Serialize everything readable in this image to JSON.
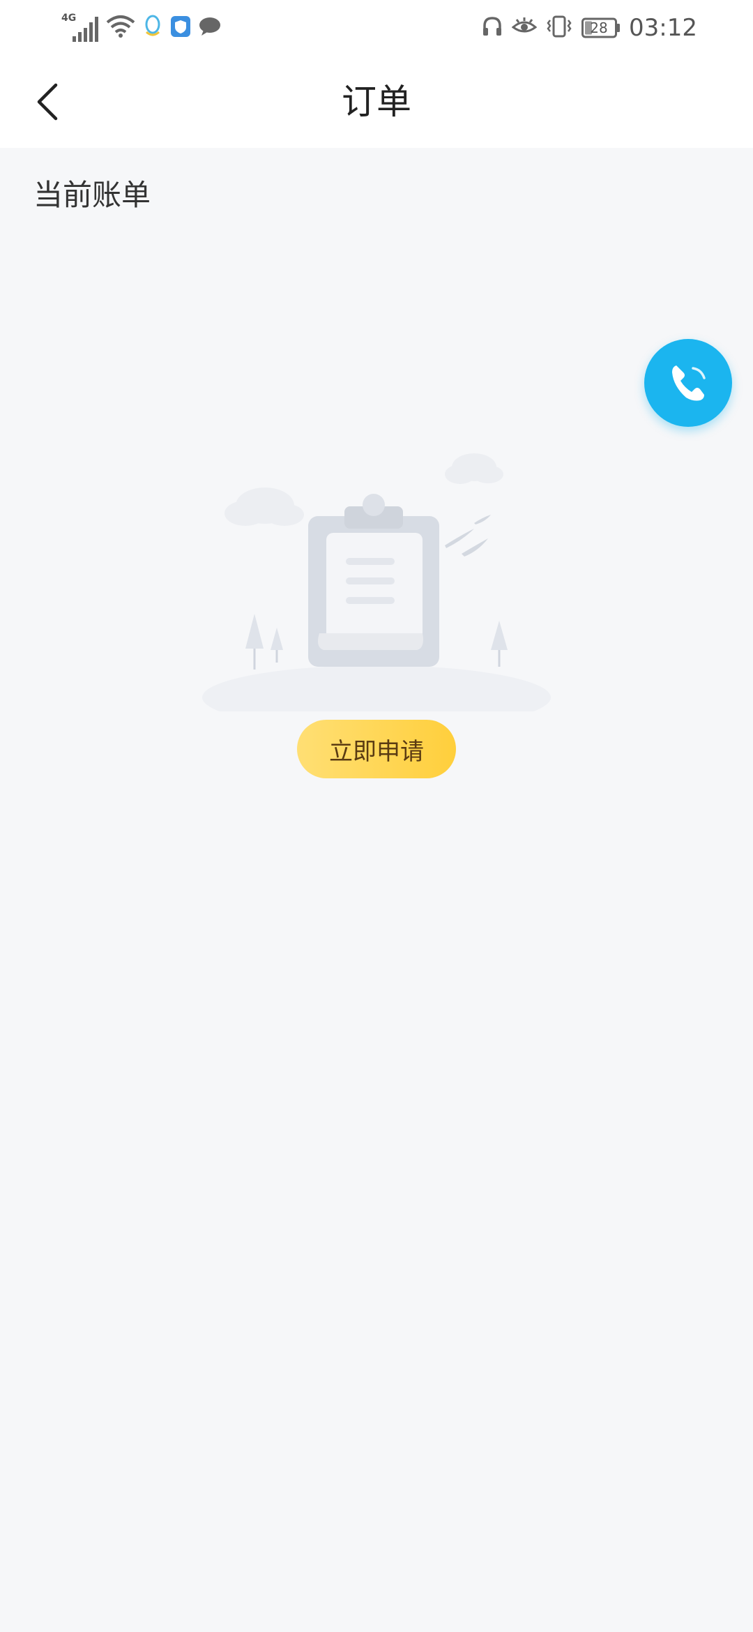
{
  "status_bar": {
    "network": "4G",
    "battery": "28",
    "time": "03:12"
  },
  "header": {
    "title": "订单"
  },
  "section": {
    "title": "当前账单"
  },
  "empty_state": {
    "button_label": "立即申请"
  },
  "colors": {
    "accent_blue": "#1bb5ef",
    "button_yellow": "#ffd24a",
    "background": "#f6f7f9"
  },
  "icons": [
    "signal-icon",
    "wifi-icon",
    "qq-icon",
    "shield-icon",
    "chat-icon",
    "headphone-icon",
    "eye-icon",
    "vibrate-icon",
    "battery-icon",
    "back-icon",
    "phone-icon"
  ]
}
